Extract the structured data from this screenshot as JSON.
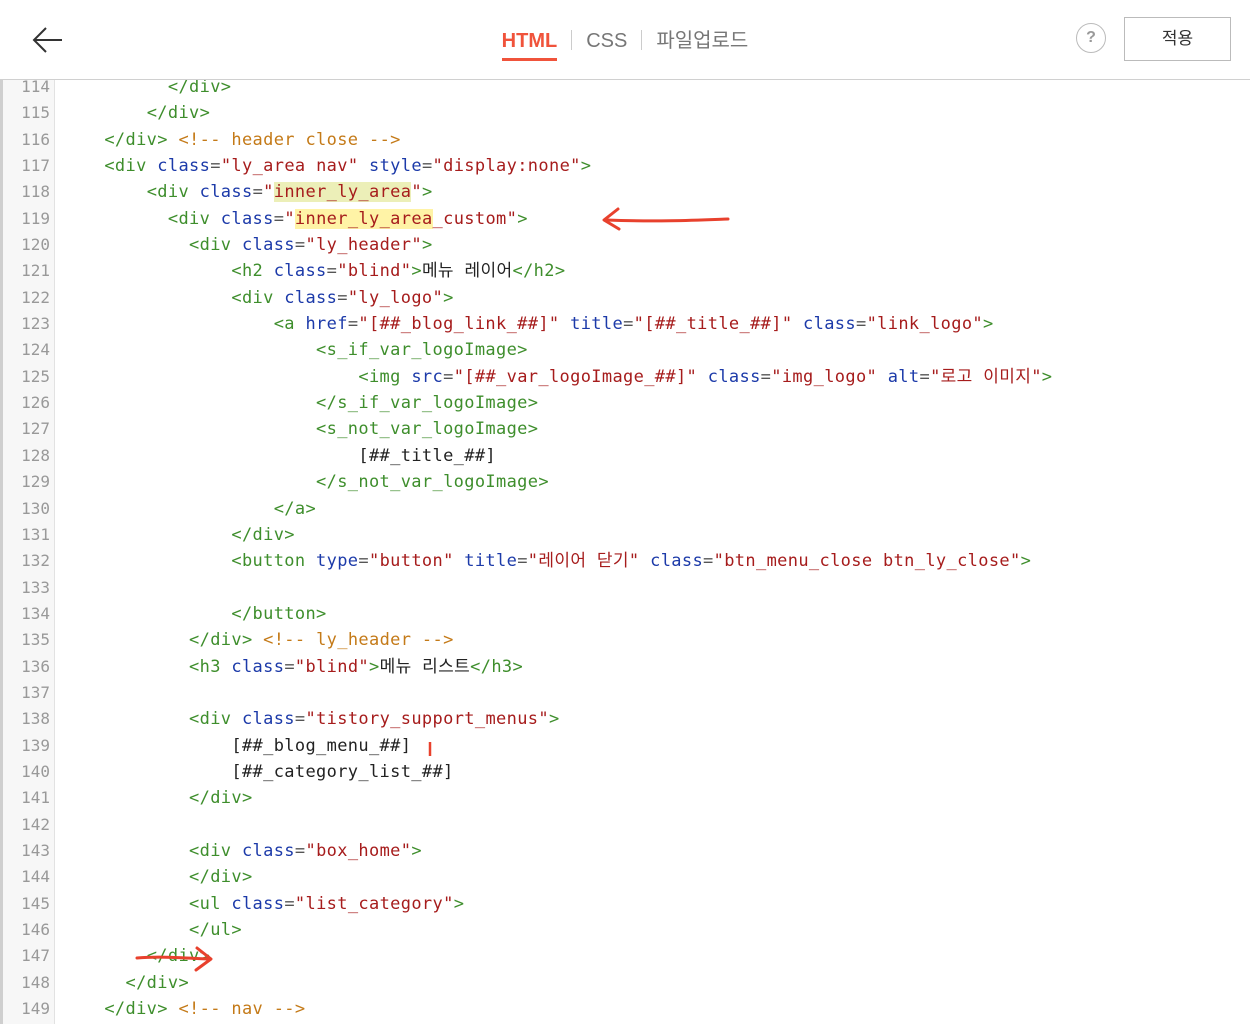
{
  "tabs": [
    {
      "label": "HTML",
      "active": true
    },
    {
      "label": "CSS",
      "active": false
    },
    {
      "label": "파일업로드",
      "active": false
    }
  ],
  "help_label": "?",
  "apply_label": "적용",
  "icons": {
    "back": "arrow-left-icon",
    "help": "question-icon"
  },
  "colors": {
    "accent": "#f0533b",
    "tag": "#3e8e2c",
    "attr": "#1c3aa9",
    "value": "#a61c1c",
    "comment": "#c47a18",
    "annotation": "#e8412d"
  },
  "code": {
    "lines": [
      {
        "n": "114",
        "indent": "          ",
        "tokens": [
          [
            "t",
            "</div>"
          ]
        ]
      },
      {
        "n": "115",
        "indent": "        ",
        "tokens": [
          [
            "t",
            "</div>"
          ]
        ]
      },
      {
        "n": "116",
        "indent": "    ",
        "tokens": [
          [
            "t",
            "</div>"
          ],
          [
            "x",
            " "
          ],
          [
            "c",
            "<!-- header close -->"
          ]
        ]
      },
      {
        "n": "117",
        "indent": "    ",
        "tokens": [
          [
            "t",
            "<div "
          ],
          [
            "a",
            "class"
          ],
          [
            "s",
            "="
          ],
          [
            "v",
            "\"ly_area nav\""
          ],
          [
            "x",
            " "
          ],
          [
            "a",
            "style"
          ],
          [
            "s",
            "="
          ],
          [
            "v",
            "\"display:none\""
          ],
          [
            "t",
            ">"
          ]
        ]
      },
      {
        "n": "118",
        "indent": "        ",
        "tokens": [
          [
            "t",
            "<div "
          ],
          [
            "a",
            "class"
          ],
          [
            "s",
            "="
          ],
          [
            "v",
            "\""
          ],
          [
            "hl2v",
            "inner_ly_area"
          ],
          [
            "v",
            "\""
          ],
          [
            "t",
            ">"
          ]
        ]
      },
      {
        "n": "119",
        "indent": "          ",
        "tokens": [
          [
            "t",
            "<div "
          ],
          [
            "a",
            "class"
          ],
          [
            "s",
            "="
          ],
          [
            "v",
            "\""
          ],
          [
            "hlv",
            "inner_ly_area"
          ],
          [
            "v",
            "_custom\""
          ],
          [
            "t",
            ">"
          ]
        ]
      },
      {
        "n": "120",
        "indent": "            ",
        "tokens": [
          [
            "t",
            "<div "
          ],
          [
            "a",
            "class"
          ],
          [
            "s",
            "="
          ],
          [
            "v",
            "\"ly_header\""
          ],
          [
            "t",
            ">"
          ]
        ]
      },
      {
        "n": "121",
        "indent": "                ",
        "tokens": [
          [
            "t",
            "<h2 "
          ],
          [
            "a",
            "class"
          ],
          [
            "s",
            "="
          ],
          [
            "v",
            "\"blind\""
          ],
          [
            "t",
            ">"
          ],
          [
            "x",
            "메뉴 레이어"
          ],
          [
            "t",
            "</h2>"
          ]
        ]
      },
      {
        "n": "122",
        "indent": "                ",
        "tokens": [
          [
            "t",
            "<div "
          ],
          [
            "a",
            "class"
          ],
          [
            "s",
            "="
          ],
          [
            "v",
            "\"ly_logo\""
          ],
          [
            "t",
            ">"
          ]
        ]
      },
      {
        "n": "123",
        "indent": "                    ",
        "tokens": [
          [
            "t",
            "<a "
          ],
          [
            "a",
            "href"
          ],
          [
            "s",
            "="
          ],
          [
            "v",
            "\"[##_blog_link_##]\""
          ],
          [
            "x",
            " "
          ],
          [
            "a",
            "title"
          ],
          [
            "s",
            "="
          ],
          [
            "v",
            "\"[##_title_##]\""
          ],
          [
            "x",
            " "
          ],
          [
            "a",
            "class"
          ],
          [
            "s",
            "="
          ],
          [
            "v",
            "\"link_logo\""
          ],
          [
            "t",
            ">"
          ]
        ]
      },
      {
        "n": "124",
        "indent": "                        ",
        "tokens": [
          [
            "t",
            "<s_if_var_logoImage>"
          ]
        ]
      },
      {
        "n": "125",
        "indent": "                            ",
        "tokens": [
          [
            "t",
            "<img "
          ],
          [
            "a",
            "src"
          ],
          [
            "s",
            "="
          ],
          [
            "v",
            "\"[##_var_logoImage_##]\""
          ],
          [
            "x",
            " "
          ],
          [
            "a",
            "class"
          ],
          [
            "s",
            "="
          ],
          [
            "v",
            "\"img_logo\""
          ],
          [
            "x",
            " "
          ],
          [
            "a",
            "alt"
          ],
          [
            "s",
            "="
          ],
          [
            "v",
            "\"로고 이미지\""
          ],
          [
            "t",
            ">"
          ]
        ]
      },
      {
        "n": "126",
        "indent": "                        ",
        "tokens": [
          [
            "t",
            "</s_if_var_logoImage>"
          ]
        ]
      },
      {
        "n": "127",
        "indent": "                        ",
        "tokens": [
          [
            "t",
            "<s_not_var_logoImage>"
          ]
        ]
      },
      {
        "n": "128",
        "indent": "                            ",
        "tokens": [
          [
            "x",
            "[##_title_##]"
          ]
        ]
      },
      {
        "n": "129",
        "indent": "                        ",
        "tokens": [
          [
            "t",
            "</s_not_var_logoImage>"
          ]
        ]
      },
      {
        "n": "130",
        "indent": "                    ",
        "tokens": [
          [
            "t",
            "</a>"
          ]
        ]
      },
      {
        "n": "131",
        "indent": "                ",
        "tokens": [
          [
            "t",
            "</div>"
          ]
        ]
      },
      {
        "n": "132",
        "indent": "                ",
        "tokens": [
          [
            "t",
            "<button "
          ],
          [
            "a",
            "type"
          ],
          [
            "s",
            "="
          ],
          [
            "v",
            "\"button\""
          ],
          [
            "x",
            " "
          ],
          [
            "a",
            "title"
          ],
          [
            "s",
            "="
          ],
          [
            "v",
            "\"레이어 닫기\""
          ],
          [
            "x",
            " "
          ],
          [
            "a",
            "class"
          ],
          [
            "s",
            "="
          ],
          [
            "v",
            "\"btn_menu_close btn_ly_close\""
          ],
          [
            "t",
            ">"
          ]
        ]
      },
      {
        "n": "133",
        "indent": "",
        "tokens": []
      },
      {
        "n": "134",
        "indent": "                ",
        "tokens": [
          [
            "t",
            "</button>"
          ]
        ]
      },
      {
        "n": "135",
        "indent": "            ",
        "tokens": [
          [
            "t",
            "</div>"
          ],
          [
            "x",
            " "
          ],
          [
            "c",
            "<!-- ly_header -->"
          ]
        ]
      },
      {
        "n": "136",
        "indent": "            ",
        "tokens": [
          [
            "t",
            "<h3 "
          ],
          [
            "a",
            "class"
          ],
          [
            "s",
            "="
          ],
          [
            "v",
            "\"blind\""
          ],
          [
            "t",
            ">"
          ],
          [
            "x",
            "메뉴 리스트"
          ],
          [
            "t",
            "</h3>"
          ]
        ]
      },
      {
        "n": "137",
        "indent": "",
        "tokens": []
      },
      {
        "n": "138",
        "indent": "            ",
        "tokens": [
          [
            "t",
            "<div "
          ],
          [
            "a",
            "class"
          ],
          [
            "s",
            "="
          ],
          [
            "v",
            "\"tistory_support_menus\""
          ],
          [
            "t",
            ">"
          ]
        ]
      },
      {
        "n": "139",
        "indent": "                ",
        "tokens": [
          [
            "x",
            "[##_blog_menu_##]"
          ]
        ]
      },
      {
        "n": "140",
        "indent": "                ",
        "tokens": [
          [
            "x",
            "[##_category_list_##]"
          ]
        ]
      },
      {
        "n": "141",
        "indent": "            ",
        "tokens": [
          [
            "t",
            "</div>"
          ]
        ]
      },
      {
        "n": "142",
        "indent": "",
        "tokens": []
      },
      {
        "n": "143",
        "indent": "            ",
        "tokens": [
          [
            "t",
            "<div "
          ],
          [
            "a",
            "class"
          ],
          [
            "s",
            "="
          ],
          [
            "v",
            "\"box_home\""
          ],
          [
            "t",
            ">"
          ]
        ]
      },
      {
        "n": "144",
        "indent": "            ",
        "tokens": [
          [
            "t",
            "</div>"
          ]
        ]
      },
      {
        "n": "145",
        "indent": "            ",
        "tokens": [
          [
            "t",
            "<ul "
          ],
          [
            "a",
            "class"
          ],
          [
            "s",
            "="
          ],
          [
            "v",
            "\"list_category\""
          ],
          [
            "t",
            ">"
          ]
        ]
      },
      {
        "n": "146",
        "indent": "            ",
        "tokens": [
          [
            "t",
            "</ul>"
          ]
        ]
      },
      {
        "n": "147",
        "indent": "        ",
        "tokens": [
          [
            "t",
            "</div>"
          ]
        ]
      },
      {
        "n": "148",
        "indent": "      ",
        "tokens": [
          [
            "t",
            "</div>"
          ]
        ]
      },
      {
        "n": "149",
        "indent": "    ",
        "tokens": [
          [
            "t",
            "</div>"
          ],
          [
            "x",
            " "
          ],
          [
            "c",
            "<!-- nav -->"
          ]
        ]
      }
    ]
  }
}
